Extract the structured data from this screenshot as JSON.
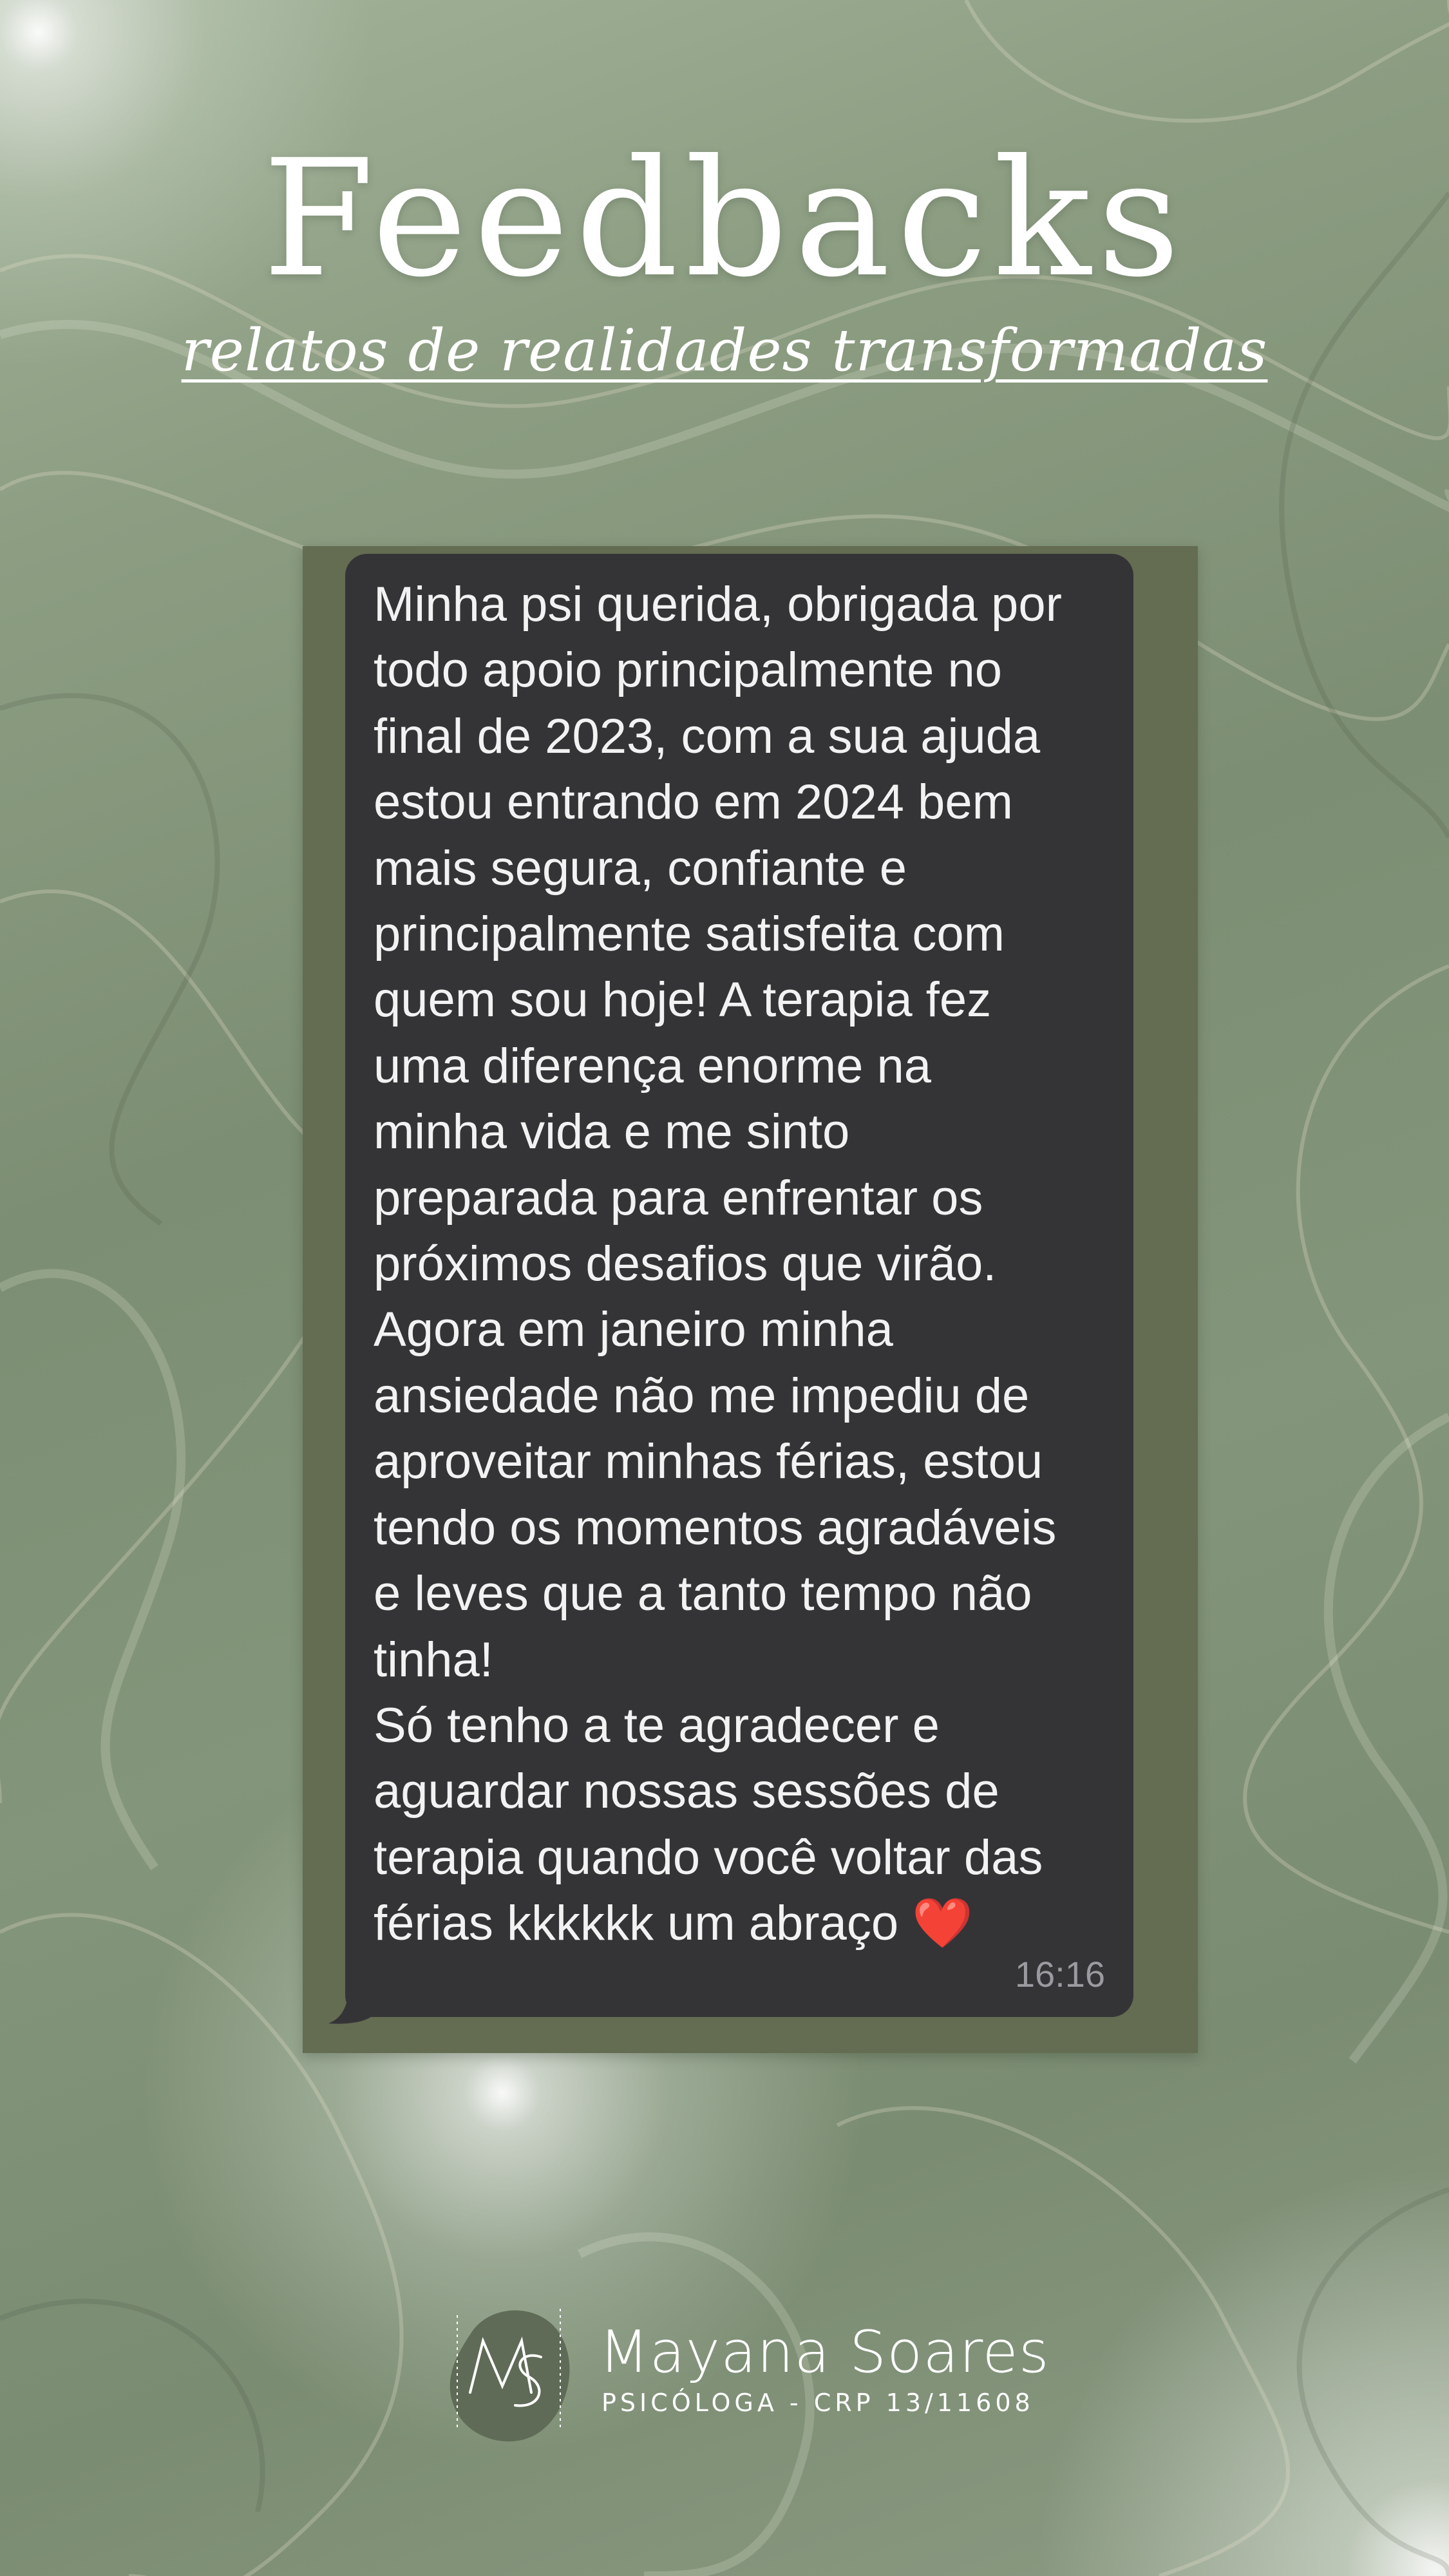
{
  "header": {
    "title": "Feedbacks",
    "subtitle": "relatos de realidades transformadas"
  },
  "message": {
    "text": "Minha psi querida, obrigada por\ntodo apoio principalmente no\nfinal de 2023, com a sua ajuda\nestou entrando em 2024 bem\nmais segura, confiante e\nprincipalmente satisfeita com\nquem sou hoje! A terapia fez\numa diferença enorme na\nminha vida e me sinto\npreparada para enfrentar os\npróximos desafios que virão.\nAgora em janeiro minha\nansiedade não me impediu de\naproveitar minhas férias, estou\ntendo os momentos agradáveis\ne leves que a tanto tempo não\ntinha!\nSó tenho a te agradecer e\naguardar nossas sessões de\nterapia quando você voltar das\nférias kkkkkk um abraço",
    "emoji": "❤️",
    "emoji_icon": "red-heart-icon",
    "time": "16:16"
  },
  "footer": {
    "logo_monogram": "MS",
    "name": "Mayana Soares",
    "credential": "PSICÓLOGA - CRP 13/11608"
  },
  "colors": {
    "background": "#7f9277",
    "frame": "#646c52",
    "bubble": "#343436",
    "message_text": "#f2f2f2",
    "timestamp": "#9a9aa0",
    "logo_blob": "#5f6b56",
    "heart": "#e0202e"
  }
}
